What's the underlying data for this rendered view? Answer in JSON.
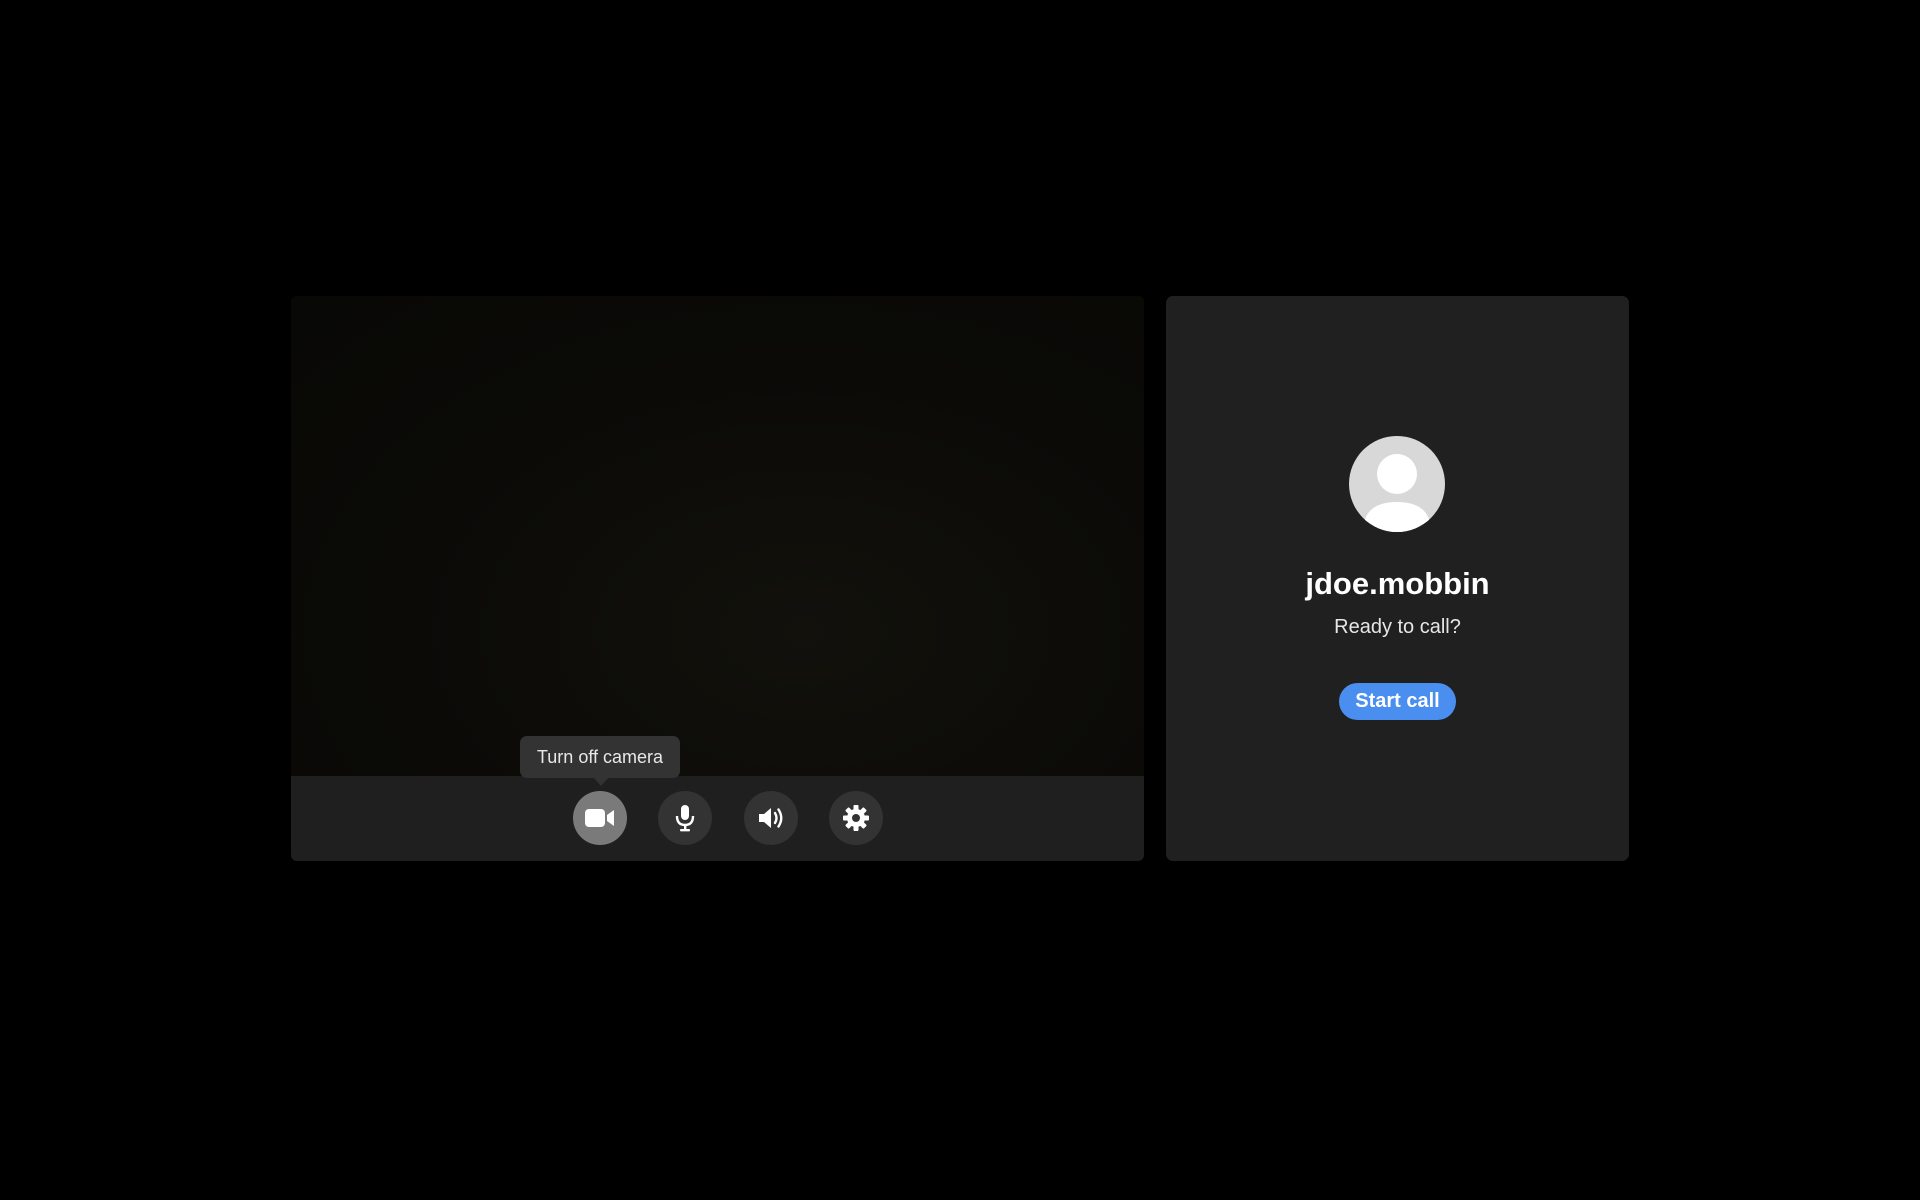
{
  "preview": {
    "tooltip": "Turn off camera",
    "controls": [
      {
        "name": "camera",
        "icon": "video-camera-icon",
        "active": true
      },
      {
        "name": "microphone",
        "icon": "microphone-icon",
        "active": false
      },
      {
        "name": "speaker",
        "icon": "speaker-icon",
        "active": false
      },
      {
        "name": "settings",
        "icon": "gear-icon",
        "active": false
      }
    ]
  },
  "call": {
    "username": "jdoe.mobbin",
    "status": "Ready to call?",
    "start_label": "Start call",
    "accent_color": "#4a8ef0"
  }
}
